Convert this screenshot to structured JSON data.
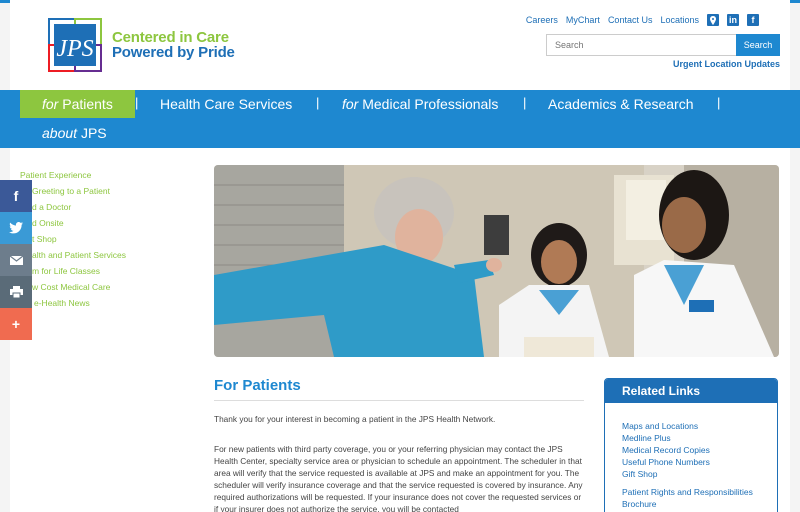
{
  "header": {
    "tagline_line1": "Centered in Care",
    "tagline_line2": "Powered by Pride",
    "top_links": [
      "Careers",
      "MyChart",
      "Contact Us",
      "Locations"
    ],
    "search_placeholder": "Search",
    "search_button": "Search",
    "urgent_link": "Urgent Location Updates"
  },
  "nav": {
    "patients_prefix": "for",
    "patients_label": "Patients",
    "health_care": "Health Care Services",
    "prof_prefix": "for",
    "prof_label": "Medical Professionals",
    "academics": "Academics & Research",
    "about_prefix": "about",
    "about_label": "JPS",
    "separator": "|"
  },
  "sidebar": {
    "items": [
      "Patient Experience",
      "Greeting to a Patient",
      "d a Doctor",
      "d Onsite",
      "t Shop",
      "alth and Patient Services",
      "m for Life Classes",
      "w Cost Medical Care",
      "e-Health News"
    ]
  },
  "main": {
    "heading": "For Patients",
    "para1": "Thank you for your interest in becoming a patient in the JPS Health Network.",
    "para2": "For new patients with third party coverage, you or your referring physician may contact the JPS Health Center, specialty service area or physician to schedule an appointment. The scheduler in that area will verify that the service requested is available at JPS and make an appointment for you. The scheduler will verify insurance coverage and that the service requested is covered by insurance. Any required authorizations will be requested. If your insurance does not cover the requested services or if your insurer does not authorize the service, you will be contacted"
  },
  "related": {
    "title": "Related Links",
    "links": [
      "Maps and Locations",
      "Medline Plus",
      "Medical Record Copies",
      "Useful Phone Numbers",
      "Gift Shop",
      "",
      "Patient Rights and Responsibilities",
      "Brochure"
    ]
  },
  "colors": {
    "brand_blue": "#1e88d0",
    "dark_blue": "#1e6fb6",
    "green": "#8dc63f",
    "facebook": "#3b5998",
    "twitter": "#3a9ad6",
    "email": "#6d7d8c",
    "print": "#5a6b78",
    "share": "#f06b50"
  }
}
